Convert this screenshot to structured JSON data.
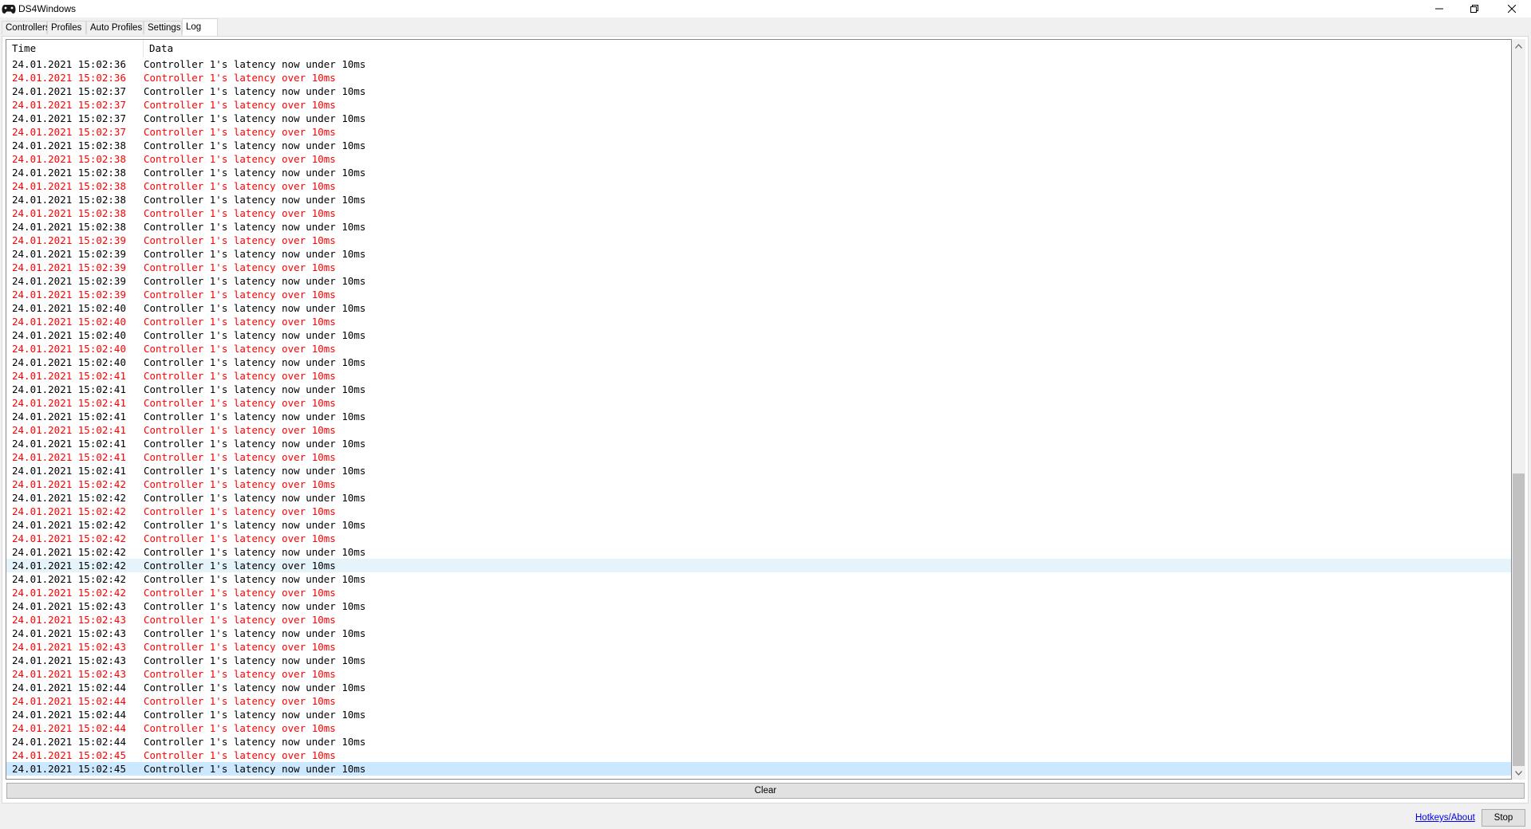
{
  "window": {
    "title": "DS4Windows",
    "icon": "gamepad-icon"
  },
  "tabs": [
    {
      "label": "Controllers",
      "active": false
    },
    {
      "label": "Profiles",
      "active": false
    },
    {
      "label": "Auto Profiles",
      "active": false
    },
    {
      "label": "Settings",
      "active": false
    },
    {
      "label": "Log",
      "active": true
    }
  ],
  "log": {
    "columns": {
      "time": "Time",
      "data": "Data"
    },
    "colors": {
      "warning": "#ff0000",
      "normal": "#000000",
      "selected_bg": "#cce8ff",
      "hover_bg": "#e5f3fb"
    },
    "entries": [
      {
        "time": "24.01.2021 15:02:36",
        "data": "Controller 1's latency now under 10ms",
        "warning": false
      },
      {
        "time": "24.01.2021 15:02:36",
        "data": "Controller 1's latency over 10ms",
        "warning": true
      },
      {
        "time": "24.01.2021 15:02:37",
        "data": "Controller 1's latency now under 10ms",
        "warning": false
      },
      {
        "time": "24.01.2021 15:02:37",
        "data": "Controller 1's latency over 10ms",
        "warning": true
      },
      {
        "time": "24.01.2021 15:02:37",
        "data": "Controller 1's latency now under 10ms",
        "warning": false
      },
      {
        "time": "24.01.2021 15:02:37",
        "data": "Controller 1's latency over 10ms",
        "warning": true
      },
      {
        "time": "24.01.2021 15:02:38",
        "data": "Controller 1's latency now under 10ms",
        "warning": false
      },
      {
        "time": "24.01.2021 15:02:38",
        "data": "Controller 1's latency over 10ms",
        "warning": true
      },
      {
        "time": "24.01.2021 15:02:38",
        "data": "Controller 1's latency now under 10ms",
        "warning": false
      },
      {
        "time": "24.01.2021 15:02:38",
        "data": "Controller 1's latency over 10ms",
        "warning": true
      },
      {
        "time": "24.01.2021 15:02:38",
        "data": "Controller 1's latency now under 10ms",
        "warning": false
      },
      {
        "time": "24.01.2021 15:02:38",
        "data": "Controller 1's latency over 10ms",
        "warning": true
      },
      {
        "time": "24.01.2021 15:02:38",
        "data": "Controller 1's latency now under 10ms",
        "warning": false
      },
      {
        "time": "24.01.2021 15:02:39",
        "data": "Controller 1's latency over 10ms",
        "warning": true
      },
      {
        "time": "24.01.2021 15:02:39",
        "data": "Controller 1's latency now under 10ms",
        "warning": false
      },
      {
        "time": "24.01.2021 15:02:39",
        "data": "Controller 1's latency over 10ms",
        "warning": true
      },
      {
        "time": "24.01.2021 15:02:39",
        "data": "Controller 1's latency now under 10ms",
        "warning": false
      },
      {
        "time": "24.01.2021 15:02:39",
        "data": "Controller 1's latency over 10ms",
        "warning": true
      },
      {
        "time": "24.01.2021 15:02:40",
        "data": "Controller 1's latency now under 10ms",
        "warning": false
      },
      {
        "time": "24.01.2021 15:02:40",
        "data": "Controller 1's latency over 10ms",
        "warning": true
      },
      {
        "time": "24.01.2021 15:02:40",
        "data": "Controller 1's latency now under 10ms",
        "warning": false
      },
      {
        "time": "24.01.2021 15:02:40",
        "data": "Controller 1's latency over 10ms",
        "warning": true
      },
      {
        "time": "24.01.2021 15:02:40",
        "data": "Controller 1's latency now under 10ms",
        "warning": false
      },
      {
        "time": "24.01.2021 15:02:41",
        "data": "Controller 1's latency over 10ms",
        "warning": true
      },
      {
        "time": "24.01.2021 15:02:41",
        "data": "Controller 1's latency now under 10ms",
        "warning": false
      },
      {
        "time": "24.01.2021 15:02:41",
        "data": "Controller 1's latency over 10ms",
        "warning": true
      },
      {
        "time": "24.01.2021 15:02:41",
        "data": "Controller 1's latency now under 10ms",
        "warning": false
      },
      {
        "time": "24.01.2021 15:02:41",
        "data": "Controller 1's latency over 10ms",
        "warning": true
      },
      {
        "time": "24.01.2021 15:02:41",
        "data": "Controller 1's latency now under 10ms",
        "warning": false
      },
      {
        "time": "24.01.2021 15:02:41",
        "data": "Controller 1's latency over 10ms",
        "warning": true
      },
      {
        "time": "24.01.2021 15:02:41",
        "data": "Controller 1's latency now under 10ms",
        "warning": false
      },
      {
        "time": "24.01.2021 15:02:42",
        "data": "Controller 1's latency over 10ms",
        "warning": true
      },
      {
        "time": "24.01.2021 15:02:42",
        "data": "Controller 1's latency now under 10ms",
        "warning": false
      },
      {
        "time": "24.01.2021 15:02:42",
        "data": "Controller 1's latency over 10ms",
        "warning": true
      },
      {
        "time": "24.01.2021 15:02:42",
        "data": "Controller 1's latency now under 10ms",
        "warning": false
      },
      {
        "time": "24.01.2021 15:02:42",
        "data": "Controller 1's latency over 10ms",
        "warning": true
      },
      {
        "time": "24.01.2021 15:02:42",
        "data": "Controller 1's latency now under 10ms",
        "warning": false
      },
      {
        "time": "24.01.2021 15:02:42",
        "data": "Controller 1's latency over 10ms",
        "warning": false,
        "hover": true
      },
      {
        "time": "24.01.2021 15:02:42",
        "data": "Controller 1's latency now under 10ms",
        "warning": false
      },
      {
        "time": "24.01.2021 15:02:42",
        "data": "Controller 1's latency over 10ms",
        "warning": true
      },
      {
        "time": "24.01.2021 15:02:43",
        "data": "Controller 1's latency now under 10ms",
        "warning": false
      },
      {
        "time": "24.01.2021 15:02:43",
        "data": "Controller 1's latency over 10ms",
        "warning": true
      },
      {
        "time": "24.01.2021 15:02:43",
        "data": "Controller 1's latency now under 10ms",
        "warning": false
      },
      {
        "time": "24.01.2021 15:02:43",
        "data": "Controller 1's latency over 10ms",
        "warning": true
      },
      {
        "time": "24.01.2021 15:02:43",
        "data": "Controller 1's latency now under 10ms",
        "warning": false
      },
      {
        "time": "24.01.2021 15:02:43",
        "data": "Controller 1's latency over 10ms",
        "warning": true
      },
      {
        "time": "24.01.2021 15:02:44",
        "data": "Controller 1's latency now under 10ms",
        "warning": false
      },
      {
        "time": "24.01.2021 15:02:44",
        "data": "Controller 1's latency over 10ms",
        "warning": true
      },
      {
        "time": "24.01.2021 15:02:44",
        "data": "Controller 1's latency now under 10ms",
        "warning": false
      },
      {
        "time": "24.01.2021 15:02:44",
        "data": "Controller 1's latency over 10ms",
        "warning": true
      },
      {
        "time": "24.01.2021 15:02:44",
        "data": "Controller 1's latency now under 10ms",
        "warning": false
      },
      {
        "time": "24.01.2021 15:02:45",
        "data": "Controller 1's latency over 10ms",
        "warning": true
      },
      {
        "time": "24.01.2021 15:02:45",
        "data": "Controller 1's latency now under 10ms",
        "warning": false,
        "selected": true
      }
    ]
  },
  "scrollbar": {
    "position_fraction": 1.0,
    "thumb_fraction": 0.41
  },
  "buttons": {
    "clear_label": "Clear",
    "stop_label": "Stop"
  },
  "footer": {
    "hotkeys_link": "Hotkeys/About"
  }
}
